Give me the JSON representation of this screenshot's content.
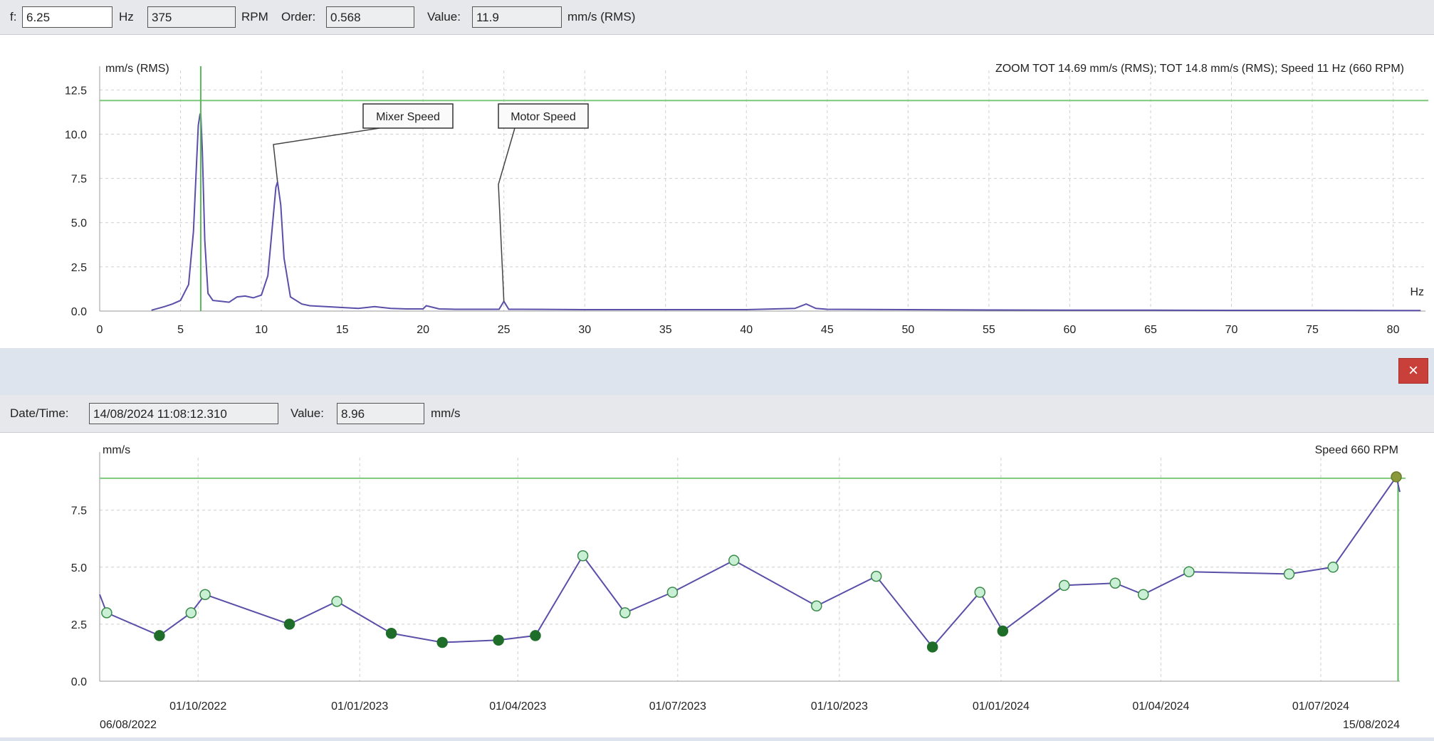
{
  "top_toolbar": {
    "f_label": "f:",
    "f_value": "6.25",
    "hz_unit": "Hz",
    "rpm_value": "375",
    "rpm_unit": "RPM",
    "order_label": "Order:",
    "order_value": "0.568",
    "value_label": "Value:",
    "value_value": "11.9",
    "value_unit": "mm/s (RMS)"
  },
  "bottom_toolbar": {
    "datetime_label": "Date/Time:",
    "datetime_value": "14/08/2024 11:08:12.310",
    "value_label": "Value:",
    "value_value": "8.96",
    "value_unit": "mm/s"
  },
  "close_button": {
    "label": "×"
  },
  "colors": {
    "grid": "#d0d0d0",
    "threshold": "#7cc97c",
    "cursor": "#58b858",
    "line": "#5a4fa8",
    "point_open": "#c9f0d4",
    "point_filled": "#1e6e2a",
    "point_border": "#3a8a4a"
  },
  "chart_data": [
    {
      "type": "line",
      "title": "ZOOM TOT 14.69 mm/s (RMS); TOT 14.8 mm/s (RMS); Speed 11 Hz (660 RPM)",
      "ylabel": "mm/s (RMS)",
      "xlabel": "Hz",
      "xlim": [
        0,
        82
      ],
      "ylim": [
        0,
        13.6
      ],
      "xticks": [
        0,
        5,
        10,
        15,
        20,
        25,
        30,
        35,
        40,
        45,
        50,
        55,
        60,
        65,
        70,
        75,
        80
      ],
      "yticks": [
        0.0,
        2.5,
        5.0,
        7.5,
        10.0,
        12.5
      ],
      "ytick_labels": [
        "0.0",
        "2.5",
        "5.0",
        "7.5",
        "10.0",
        "12.5"
      ],
      "grid": true,
      "threshold": 11.9,
      "cursor_x": 6.25,
      "series": [
        {
          "x": [
            3.2,
            4.0,
            4.5,
            5.0,
            5.5,
            5.8,
            6.0,
            6.1,
            6.2,
            6.25,
            6.35,
            6.5,
            6.7,
            7.0,
            7.5,
            8.0,
            8.5,
            9.0,
            9.5,
            10.0,
            10.4,
            10.7,
            10.9,
            11.0,
            11.2,
            11.4,
            11.8,
            12.5,
            13.0,
            14.0,
            15.0,
            16.0,
            17.0,
            18.0,
            19.0,
            20.0,
            20.2,
            21.0,
            22.0,
            23.0,
            24.0,
            24.7,
            25.0,
            25.3,
            26.0,
            30.0,
            35.0,
            40.0,
            43.0,
            43.7,
            44.3,
            45.0,
            50.0,
            55.0,
            60.0,
            65.0,
            70.0,
            75.0,
            80.0,
            81.7
          ],
          "y": [
            0.05,
            0.25,
            0.4,
            0.6,
            1.5,
            4.5,
            8.5,
            10.5,
            11.1,
            11.2,
            9.0,
            4.0,
            1.0,
            0.6,
            0.55,
            0.5,
            0.8,
            0.85,
            0.75,
            0.9,
            2.0,
            5.0,
            7.0,
            7.3,
            6.0,
            3.0,
            0.8,
            0.4,
            0.3,
            0.25,
            0.2,
            0.15,
            0.25,
            0.15,
            0.12,
            0.12,
            0.3,
            0.12,
            0.1,
            0.1,
            0.1,
            0.1,
            0.55,
            0.1,
            0.1,
            0.08,
            0.08,
            0.08,
            0.15,
            0.4,
            0.15,
            0.1,
            0.08,
            0.06,
            0.05,
            0.05,
            0.04,
            0.04,
            0.03,
            0.03
          ]
        }
      ],
      "annotations": [
        {
          "text": "Mixer Speed",
          "x": 11.0,
          "y": 7.3
        },
        {
          "text": "Motor Speed",
          "x": 25.0,
          "y": 0.55
        }
      ]
    },
    {
      "type": "line",
      "ylabel": "mm/s",
      "annotation_right": "Speed 660 RPM",
      "xlim": [
        "2022-08-06",
        "2024-08-15"
      ],
      "ylim": [
        0,
        9.8
      ],
      "xticks": [
        "2022-10-01",
        "2023-01-01",
        "2023-04-01",
        "2023-07-01",
        "2023-10-01",
        "2024-01-01",
        "2024-04-01",
        "2024-07-01"
      ],
      "xtick_labels": [
        "01/10/2022",
        "01/01/2023",
        "01/04/2023",
        "01/07/2023",
        "01/10/2023",
        "01/01/2024",
        "01/04/2024",
        "01/07/2024"
      ],
      "x_start_label": "06/08/2022",
      "x_end_label": "15/08/2024",
      "yticks": [
        0.0,
        2.5,
        5.0,
        7.5
      ],
      "ytick_labels": [
        "0.0",
        "2.5",
        "5.0",
        "7.5"
      ],
      "grid": true,
      "threshold": 8.9,
      "cursor_x": "2024-08-14",
      "series": [
        {
          "x": [
            "2022-08-06",
            "2022-08-10",
            "2022-09-09",
            "2022-09-27",
            "2022-10-05",
            "2022-11-22",
            "2022-12-19",
            "2023-01-19",
            "2023-02-17",
            "2023-03-21",
            "2023-04-11",
            "2023-05-08",
            "2023-06-01",
            "2023-06-28",
            "2023-08-02",
            "2023-09-18",
            "2023-10-22",
            "2023-11-23",
            "2023-12-20",
            "2024-01-02",
            "2024-02-06",
            "2024-03-06",
            "2024-03-22",
            "2024-04-17",
            "2024-06-13",
            "2024-07-08",
            "2024-08-13",
            "2024-08-15"
          ],
          "y": [
            3.8,
            3.0,
            2.0,
            3.0,
            3.8,
            2.5,
            3.5,
            2.1,
            1.7,
            1.8,
            2.0,
            5.5,
            3.0,
            3.9,
            5.3,
            3.3,
            4.6,
            1.5,
            3.9,
            2.2,
            4.2,
            4.3,
            3.8,
            4.8,
            4.7,
            5.0,
            8.96,
            8.3
          ],
          "markers": [
            "none",
            "open",
            "filled",
            "open",
            "open",
            "filled",
            "open",
            "filled",
            "filled",
            "filled",
            "filled",
            "open",
            "open",
            "open",
            "open",
            "open",
            "open",
            "filled",
            "open",
            "filled",
            "open",
            "open",
            "open",
            "open",
            "open",
            "open",
            "selected",
            "none"
          ]
        }
      ]
    }
  ]
}
